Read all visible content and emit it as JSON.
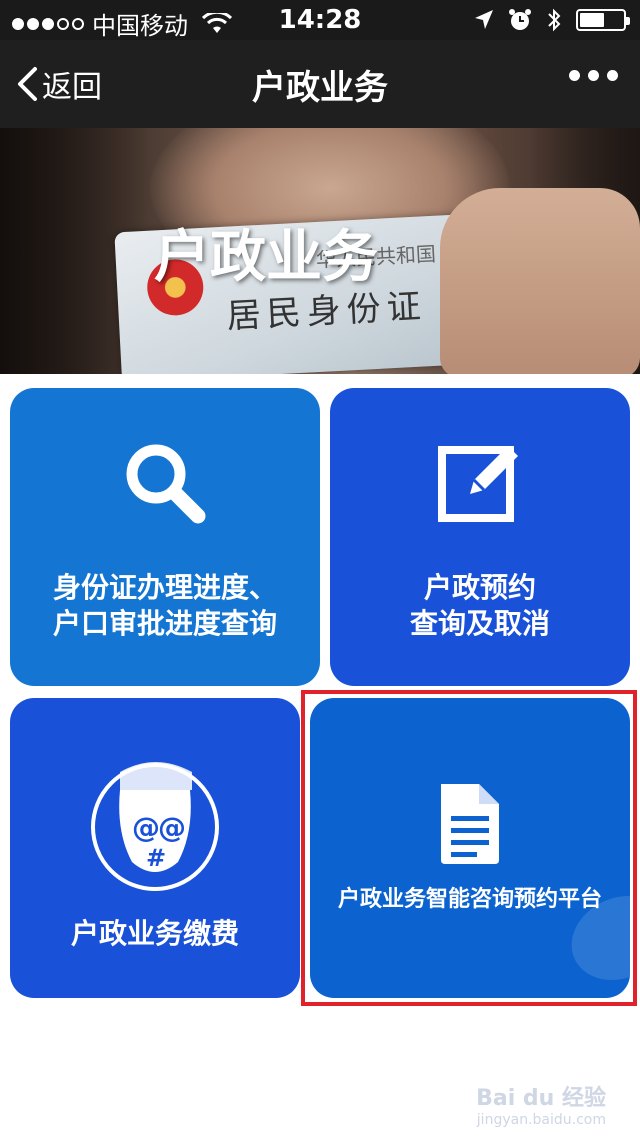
{
  "status_bar": {
    "carrier": "中国移动",
    "time": "14:28"
  },
  "nav": {
    "back_label": "返回",
    "title": "户政业务"
  },
  "banner": {
    "title": "户政业务",
    "card_text": "居民身份证",
    "card_top_text": "华人民共和国"
  },
  "tiles": [
    {
      "lines": [
        "身份证办理进度、",
        "户口审批进度查询"
      ],
      "icon": "search-icon"
    },
    {
      "lines": [
        "户政预约",
        "查询及取消"
      ],
      "icon": "edit-icon"
    },
    {
      "lines": [
        "户政业务缴费"
      ],
      "icon": "face-icon"
    },
    {
      "lines": [
        "户政业务智能咨询预约平台"
      ],
      "icon": "document-icon"
    }
  ],
  "watermark": {
    "brand": "Bai du 经验",
    "url": "jingyan.baidu.com"
  },
  "colors": {
    "tile_light_blue": "#1476d2",
    "tile_blue": "#1951d8",
    "tile_mid_blue": "#0c63cf",
    "highlight_red": "#e0222a"
  }
}
